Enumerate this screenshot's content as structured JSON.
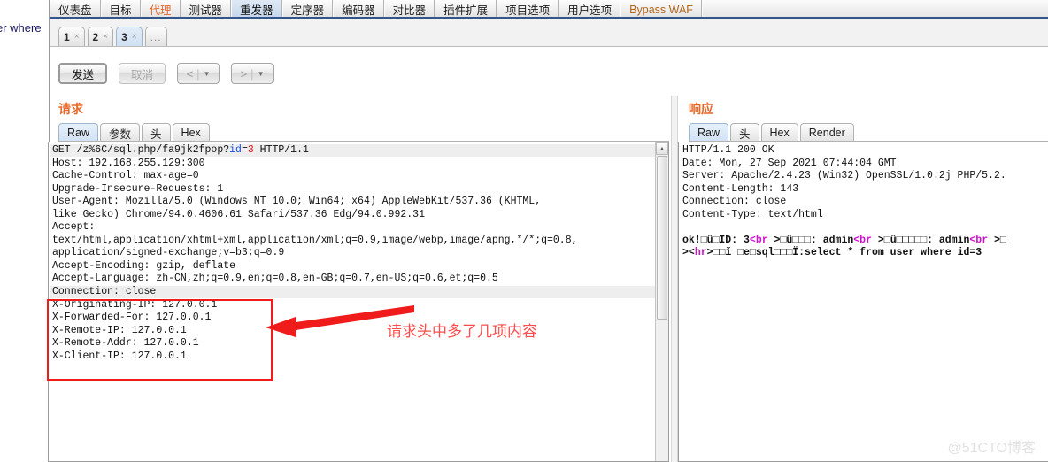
{
  "background": {
    "leftover_text": "er where"
  },
  "main_tabs": [
    {
      "label": "仪表盘",
      "state": "normal"
    },
    {
      "label": "目标",
      "state": "normal"
    },
    {
      "label": "代理",
      "state": "accent"
    },
    {
      "label": "测试器",
      "state": "normal"
    },
    {
      "label": "重发器",
      "state": "active"
    },
    {
      "label": "定序器",
      "state": "normal"
    },
    {
      "label": "编码器",
      "state": "normal"
    },
    {
      "label": "对比器",
      "state": "normal"
    },
    {
      "label": "插件扩展",
      "state": "normal"
    },
    {
      "label": "项目选项",
      "state": "normal"
    },
    {
      "label": "用户选项",
      "state": "normal"
    },
    {
      "label": "Bypass WAF",
      "state": "accent2"
    }
  ],
  "numbered_tabs": [
    {
      "label": "1",
      "close": "×",
      "active": false
    },
    {
      "label": "2",
      "close": "×",
      "active": false
    },
    {
      "label": "3",
      "close": "×",
      "active": true
    },
    {
      "label": "...",
      "close": "",
      "active": false
    }
  ],
  "toolbar": {
    "send_label": "发送",
    "cancel_label": "取消",
    "prev_label": "<",
    "next_label": ">",
    "separator": "|",
    "caret": "▼"
  },
  "request_panel": {
    "title": "请求",
    "tabs": [
      {
        "label": "Raw",
        "active": true
      },
      {
        "label": "参数",
        "active": false
      },
      {
        "label": "头",
        "active": false
      },
      {
        "label": "Hex",
        "active": false
      }
    ],
    "lines": [
      "GET /z%6C/sql.php/fa9jk2fpop?id=3 HTTP/1.1",
      "Host: 192.168.255.129:300",
      "Cache-Control: max-age=0",
      "Upgrade-Insecure-Requests: 1",
      "User-Agent: Mozilla/5.0 (Windows NT 10.0; Win64; x64) AppleWebKit/537.36 (KHTML,",
      "like Gecko) Chrome/94.0.4606.61 Safari/537.36 Edg/94.0.992.31",
      "Accept:",
      "text/html,application/xhtml+xml,application/xml;q=0.9,image/webp,image/apng,*/*;q=0.8,",
      "application/signed-exchange;v=b3;q=0.9",
      "Accept-Encoding: gzip, deflate",
      "Accept-Language: zh-CN,zh;q=0.9,en;q=0.8,en-GB;q=0.7,en-US;q=0.6,et;q=0.5",
      "Connection: close",
      "X-Originating-IP: 127.0.0.1",
      "X-Forwarded-For: 127.0.0.1",
      "X-Remote-IP: 127.0.0.1",
      "X-Remote-Addr: 127.0.0.1",
      "X-Client-IP: 127.0.0.1"
    ],
    "first_line_parts": {
      "prefix": "GET /z%6C/sql.php/fa9jk2fpop?",
      "param": "id",
      "equals": "=",
      "value": "3",
      "suffix": " HTTP/1.1"
    }
  },
  "response_panel": {
    "title": "响应",
    "tabs": [
      {
        "label": "Raw",
        "active": true
      },
      {
        "label": "头",
        "active": false
      },
      {
        "label": "Hex",
        "active": false
      },
      {
        "label": "Render",
        "active": false
      }
    ],
    "header_lines": [
      "HTTP/1.1 200 OK",
      "Date: Mon, 27 Sep 2021 07:44:04 GMT",
      "Server: Apache/2.4.23 (Win32) OpenSSL/1.0.2j PHP/5.2.",
      "Content-Length: 143",
      "Connection: close",
      "Content-Type: text/html"
    ],
    "body_line1_parts": [
      {
        "text": "ok!□û□ID: 3",
        "style": "bold"
      },
      {
        "text": "<br",
        "style": "tag"
      },
      {
        "text": " >□û□□□: admin",
        "style": "bold"
      },
      {
        "text": "<br",
        "style": "tag"
      },
      {
        "text": " >□û□□□□□: admin",
        "style": "bold"
      },
      {
        "text": "<br",
        "style": "tag"
      },
      {
        "text": " >□",
        "style": "bold"
      }
    ],
    "body_line2_parts": [
      {
        "text": "><",
        "style": "bold"
      },
      {
        "text": "hr",
        "style": "tag"
      },
      {
        "text": ">□□ǐ □e□sql□□□Ï:select * from user where id=3",
        "style": "bold"
      }
    ]
  },
  "annotation": {
    "text": "请求头中多了几项内容",
    "box_color": "#f01c1c",
    "text_color": "#fb4d4d"
  },
  "watermark": {
    "text": "@51CTO博客"
  }
}
